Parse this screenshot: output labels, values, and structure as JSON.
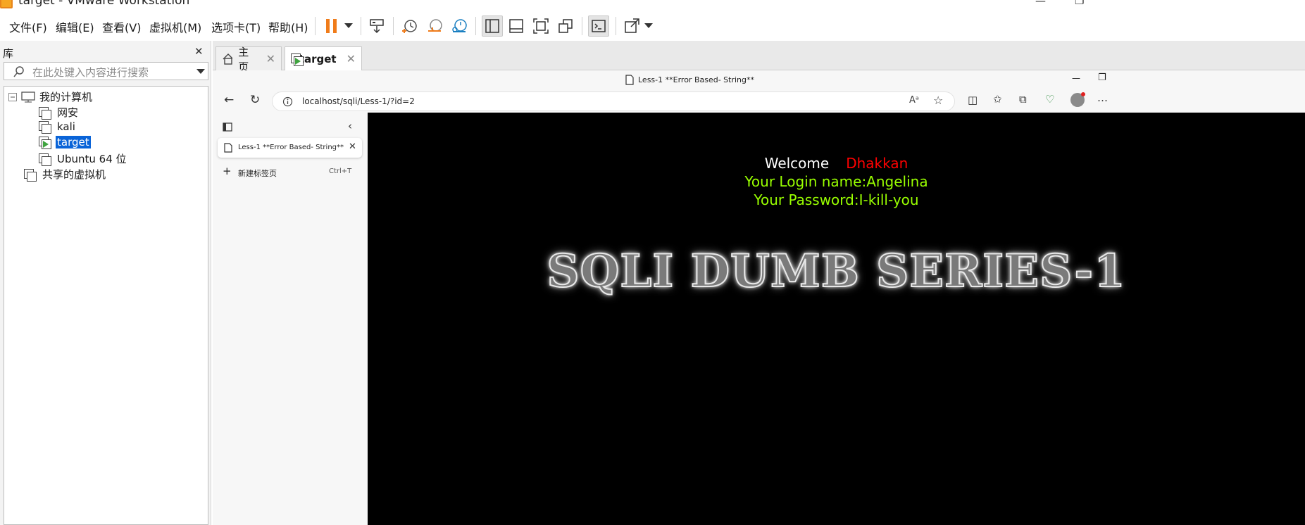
{
  "window": {
    "title": "target - VMware Workstation"
  },
  "menu": {
    "items": [
      "文件(F)",
      "编辑(E)",
      "查看(V)",
      "虚拟机(M)",
      "选项卡(T)",
      "帮助(H)"
    ]
  },
  "toolbar": {
    "icons": [
      "pause-icon",
      "dropdown-icon",
      "send-ctrl-alt-del-icon",
      "snapshot-take-icon",
      "snapshot-revert-icon",
      "snapshot-manager-icon",
      "library-view-icon",
      "thumbnail-bar-icon",
      "fullscreen-icon",
      "unity-icon",
      "console-icon",
      "stretch-guest-icon",
      "dropdown-icon"
    ]
  },
  "library": {
    "title": "库",
    "search_placeholder": "在此处键入内容进行搜索",
    "tree": {
      "root": "我的计算机",
      "vms": [
        "网安",
        "kali",
        "target",
        "Ubuntu 64 位"
      ],
      "selected": "target",
      "shared": "共享的虚拟机"
    }
  },
  "vm_tabs": [
    {
      "label": "主页",
      "icon": "home-icon"
    },
    {
      "label": "target",
      "icon": "vm-running-icon",
      "active": true
    }
  ],
  "browser": {
    "window_title": "Less-1 **Error Based- String**",
    "url": "localhost/sqli/Less-1/?id=2",
    "vertical_tab": {
      "title": "Less-1 **Error Based- String**"
    },
    "new_tab": {
      "label": "新建标签页",
      "shortcut": "Ctrl+T"
    }
  },
  "page": {
    "welcome": "Welcome",
    "welcome_name": "Dhakkan",
    "login_line": "Your Login name:Angelina",
    "password_line": "Your Password:I-kill-you",
    "banner": "SQLI DUMB SERIES-1",
    "colors": {
      "welcome": "#ffffff",
      "name": "#ff0000",
      "info": "#99ff00",
      "background": "#000000"
    }
  }
}
